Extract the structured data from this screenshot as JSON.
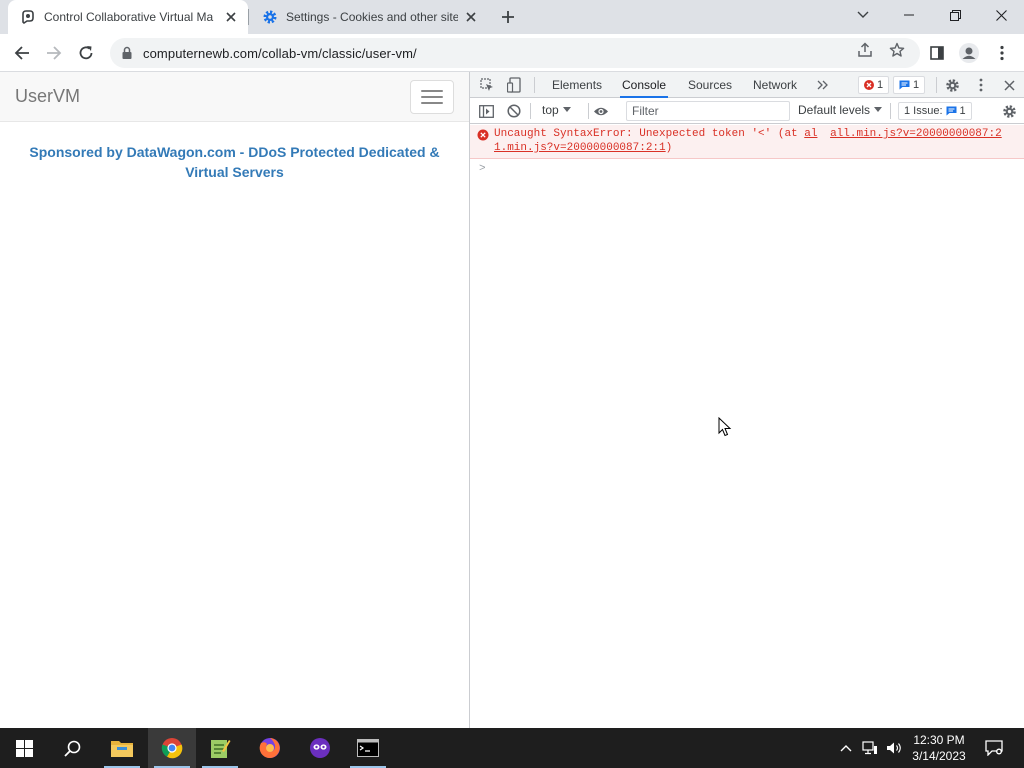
{
  "tabs": [
    {
      "title": "Control Collaborative Virtual Ma",
      "active": true
    },
    {
      "title": "Settings - Cookies and other site",
      "active": false
    }
  ],
  "omnibox": {
    "url": "computernewb.com/collab-vm/classic/user-vm/"
  },
  "page": {
    "brand": "UserVM",
    "sponsor": "Sponsored by DataWagon.com - DDoS Protected Dedicated & Virtual Servers"
  },
  "devtools": {
    "tabs": [
      "Elements",
      "Console",
      "Sources",
      "Network"
    ],
    "active_tab": "Console",
    "error_count": "1",
    "message_count": "1",
    "context": "top",
    "filter_placeholder": "Filter",
    "levels": "Default levels",
    "issues_label": "1 Issue:",
    "issues_count": "1",
    "error": {
      "prefix": "Uncaught SyntaxError: Unexpected token '<' (at ",
      "link1": "al",
      "link2": "all.min.js?v=20000000087:2",
      "line2": "1.min.js?v=20000000087:2:1",
      "suffix": ")"
    },
    "prompt": ">"
  },
  "taskbar": {
    "time": "12:30 PM",
    "date": "3/14/2023"
  },
  "colors": {
    "link_blue": "#337ab7",
    "error_red": "#d93025",
    "accent": "#1a73e8"
  }
}
